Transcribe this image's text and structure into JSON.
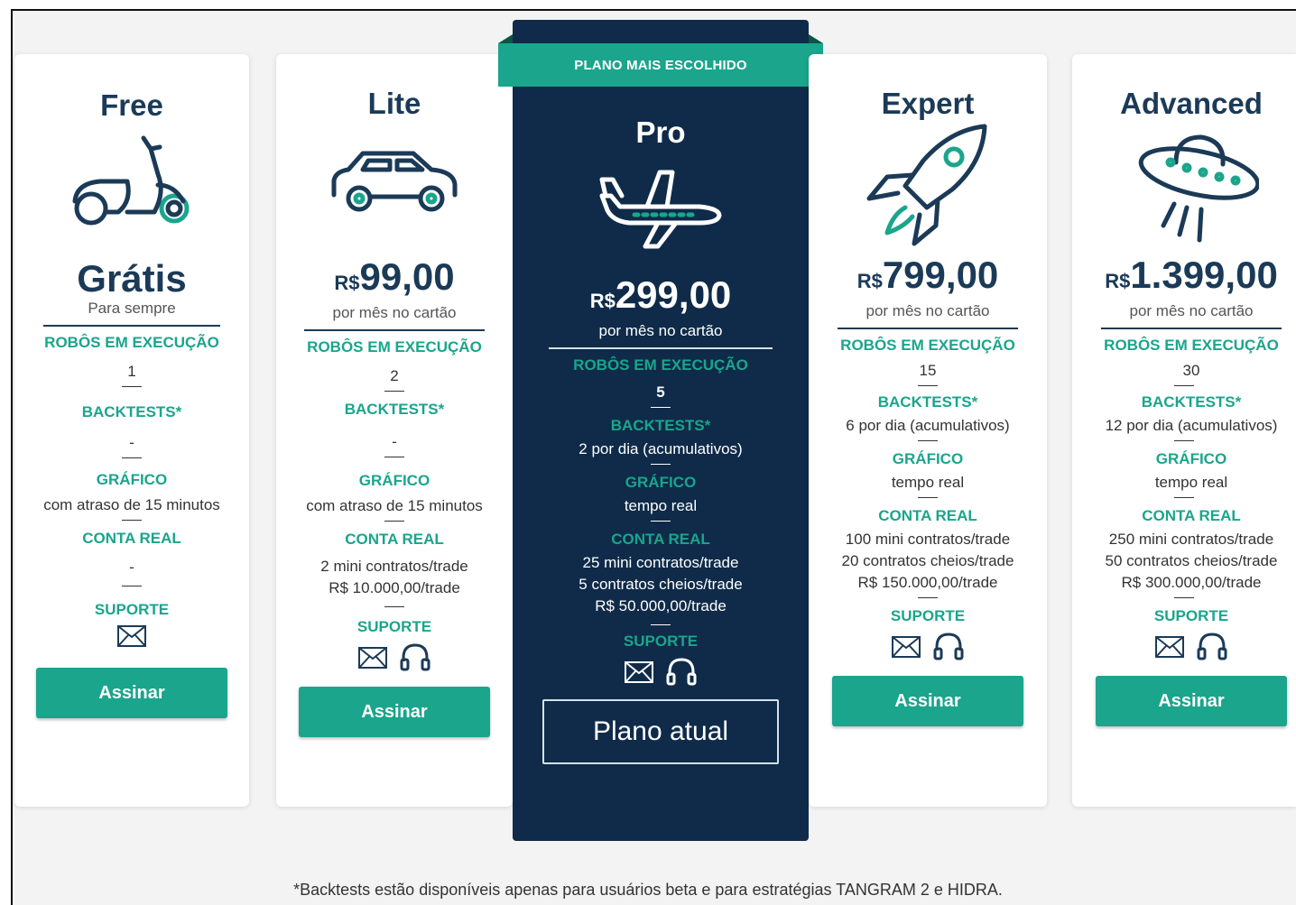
{
  "ribbon": "PLANO MAIS ESCOLHIDO",
  "plans": [
    {
      "name": "Free",
      "icon": "scooter-icon",
      "price": "Grátis",
      "price_sub": "Para sempre",
      "robots_label": "ROBÔS EM EXECUÇÃO",
      "robots": "1",
      "backtests_label": "BACKTESTS*",
      "backtests": "-",
      "chart_label": "GRÁFICO",
      "chart": "com atraso de 15 minutos",
      "account_label": "CONTA REAL",
      "account": [
        "-"
      ],
      "support_label": "SUPORTE",
      "support": [
        "email-icon"
      ],
      "button": "Assinar"
    },
    {
      "name": "Lite",
      "icon": "car-icon",
      "currency": "R$",
      "price": "99,00",
      "price_sub": "por mês no cartão",
      "robots_label": "ROBÔS EM EXECUÇÃO",
      "robots": "2",
      "backtests_label": "BACKTESTS*",
      "backtests": "-",
      "chart_label": "GRÁFICO",
      "chart": "com atraso de 15 minutos",
      "account_label": "CONTA REAL",
      "account": [
        "2 mini contratos/trade",
        "R$ 10.000,00/trade"
      ],
      "support_label": "SUPORTE",
      "support": [
        "email-icon",
        "headset-icon"
      ],
      "button": "Assinar"
    },
    {
      "name": "Pro",
      "icon": "airplane-icon",
      "currency": "R$",
      "price": "299,00",
      "price_sub": "por mês no cartão",
      "robots_label": "ROBÔS EM EXECUÇÃO",
      "robots": "5",
      "backtests_label": "BACKTESTS*",
      "backtests": "2 por dia (acumulativos)",
      "chart_label": "GRÁFICO",
      "chart": "tempo real",
      "account_label": "CONTA REAL",
      "account": [
        "25 mini contratos/trade",
        "5 contratos cheios/trade",
        "R$ 50.000,00/trade"
      ],
      "support_label": "SUPORTE",
      "support": [
        "email-icon",
        "headset-icon"
      ],
      "button": "Plano atual"
    },
    {
      "name": "Expert",
      "icon": "rocket-icon",
      "currency": "R$",
      "price": "799,00",
      "price_sub": "por mês no cartão",
      "robots_label": "ROBÔS EM EXECUÇÃO",
      "robots": "15",
      "backtests_label": "BACKTESTS*",
      "backtests": "6 por dia (acumulativos)",
      "chart_label": "GRÁFICO",
      "chart": "tempo real",
      "account_label": "CONTA REAL",
      "account": [
        "100 mini contratos/trade",
        "20 contratos cheios/trade",
        "R$ 150.000,00/trade"
      ],
      "support_label": "SUPORTE",
      "support": [
        "email-icon",
        "headset-icon"
      ],
      "button": "Assinar"
    },
    {
      "name": "Advanced",
      "icon": "ufo-icon",
      "currency": "R$",
      "price": "1.399,00",
      "price_sub": "por mês no cartão",
      "robots_label": "ROBÔS EM EXECUÇÃO",
      "robots": "30",
      "backtests_label": "BACKTESTS*",
      "backtests": "12 por dia (acumulativos)",
      "chart_label": "GRÁFICO",
      "chart": "tempo real",
      "account_label": "CONTA REAL",
      "account": [
        "250 mini contratos/trade",
        "50 contratos cheios/trade",
        "R$ 300.000,00/trade"
      ],
      "support_label": "SUPORTE",
      "support": [
        "email-icon",
        "headset-icon"
      ],
      "button": "Assinar"
    }
  ],
  "footnote": "*Backtests estão disponíveis apenas para usuários beta e para estratégias TANGRAM 2 e HIDRA.",
  "colors": {
    "accent": "#1aa58c",
    "navy": "#0f2b49",
    "text": "#1b3a57"
  }
}
